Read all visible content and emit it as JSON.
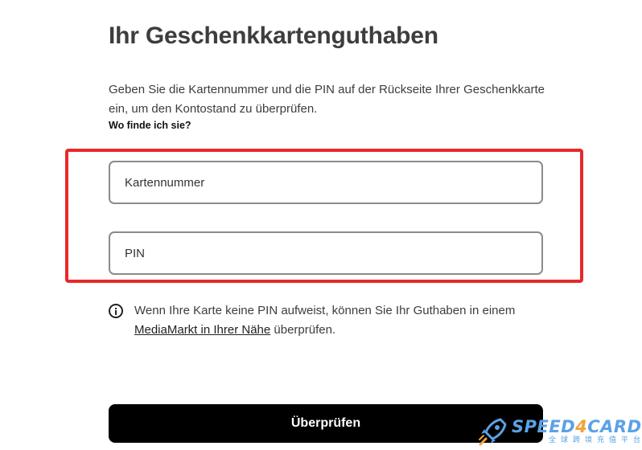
{
  "page": {
    "title": "Ihr Geschenkkartenguthaben",
    "description": "Geben Sie die Kartennummer und die PIN auf der Rückseite Ihrer Geschenkkarte ein, um den Kontostand zu überprüfen.",
    "where_link": "Wo finde ich sie?"
  },
  "form": {
    "card_number_placeholder": "Kartennummer",
    "pin_placeholder": "PIN",
    "highlight_color": "#e8282b"
  },
  "info": {
    "icon": "info-icon",
    "text_before": "Wenn Ihre Karte keine PIN aufweist, können Sie Ihr Guthaben in einem ",
    "link_text": "MediaMarkt in Ihrer Nähe",
    "text_after": " überprüfen."
  },
  "submit": {
    "label": "Überprüfen"
  },
  "watermark": {
    "brand_part1": "SPEED",
    "brand_part2": "4",
    "brand_part3": "CARD",
    "subtitle": "全球跨境充值平台",
    "icon": "rocket-icon",
    "colors": {
      "primary": "#5aa2e6",
      "accent": "#f2a23a"
    }
  },
  "colors": {
    "button_bg": "#000000",
    "button_text": "#ffffff",
    "field_border": "#8a8a8a"
  }
}
